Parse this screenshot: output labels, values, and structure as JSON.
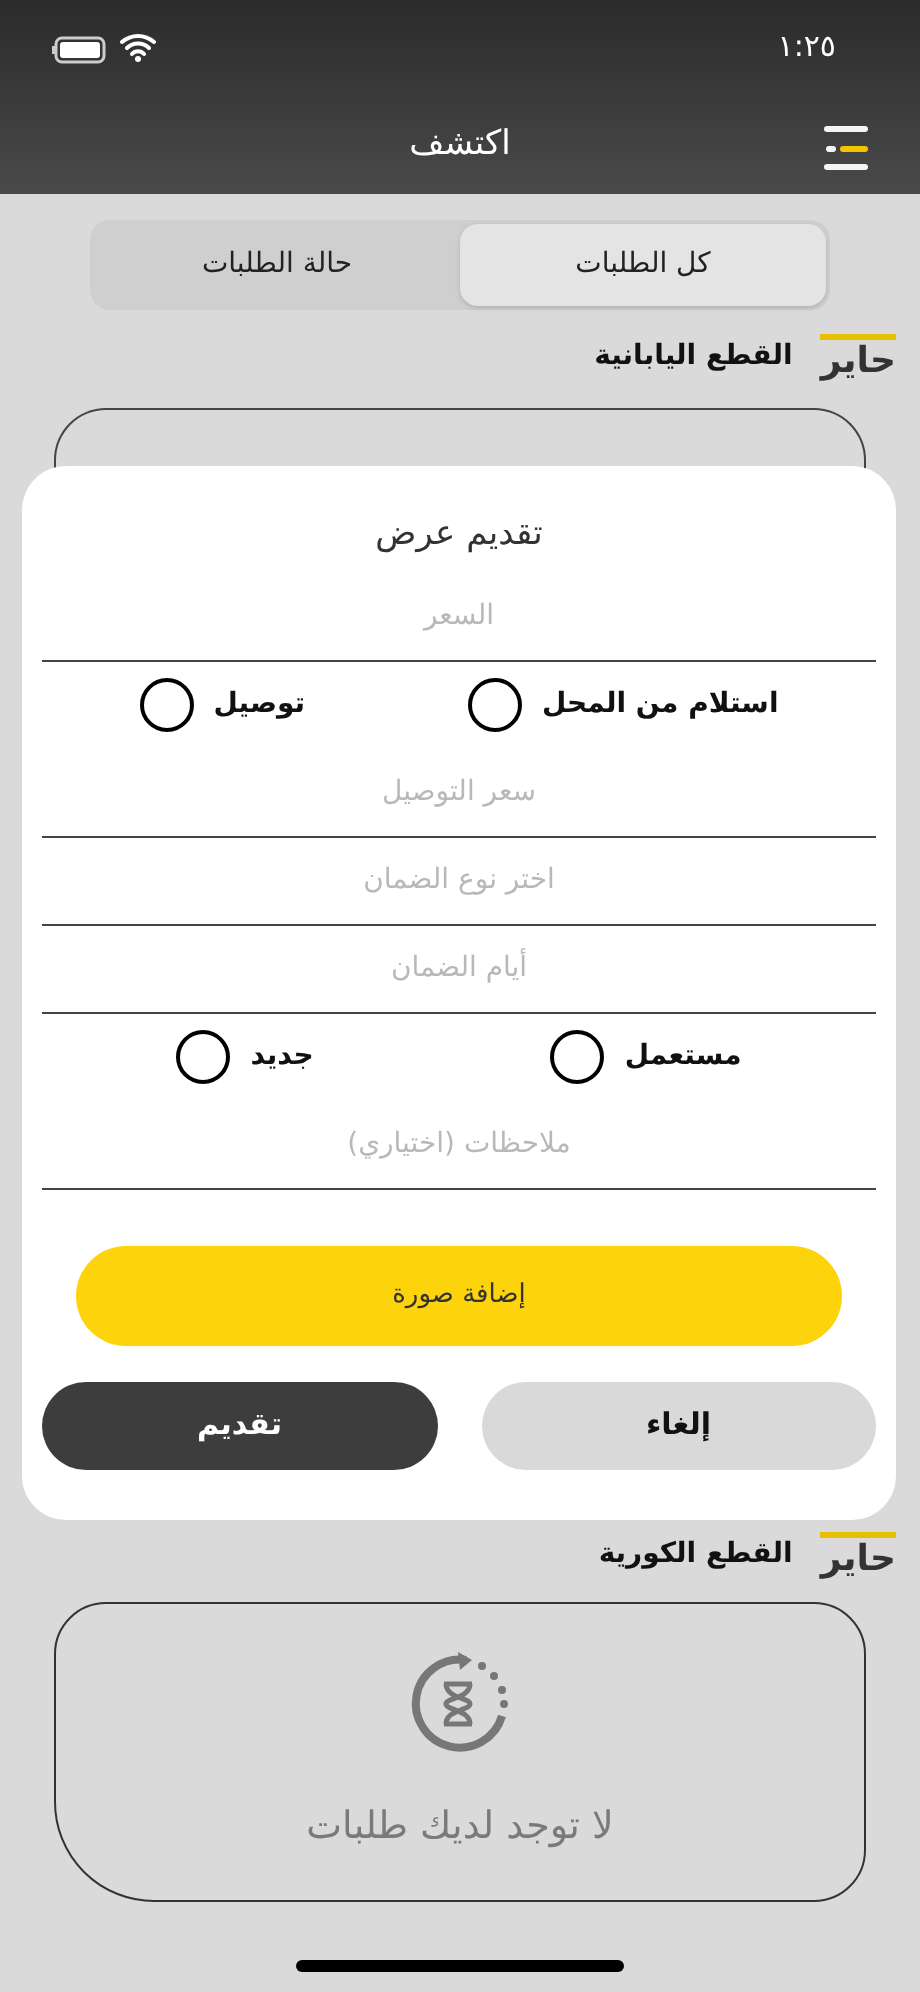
{
  "status_bar": {
    "time": "١:٢٥"
  },
  "header": {
    "title": "اكتشف"
  },
  "tabs": [
    {
      "label": "كل الطلبات",
      "selected": true
    },
    {
      "label": "حالة الطلبات",
      "selected": false
    }
  ],
  "sections": [
    {
      "logo": "حاير",
      "title": "القطع اليابانية"
    },
    {
      "logo": "حاير",
      "title": "القطع الكورية"
    }
  ],
  "empty_state": {
    "message": "لا توجد لديك طلبات"
  },
  "dialog": {
    "title": "تقديم عرض",
    "rows": [
      {
        "kind": "field",
        "placeholder": "السعر"
      },
      {
        "kind": "radios",
        "options": [
          {
            "label": "استلام من المحل",
            "selected": false
          },
          {
            "label": "توصيل",
            "selected": false
          }
        ]
      },
      {
        "kind": "field",
        "placeholder": "سعر التوصيل"
      },
      {
        "kind": "field",
        "placeholder": "اختر نوع الضمان"
      },
      {
        "kind": "field",
        "placeholder": "أيام الضمان"
      },
      {
        "kind": "radios",
        "options": [
          {
            "label": "مستعمل",
            "selected": false
          },
          {
            "label": "جديد",
            "selected": false
          }
        ]
      },
      {
        "kind": "field",
        "placeholder": "ملاحظات (اختياري)"
      }
    ],
    "add_image_button": "إضافة صورة",
    "buttons": [
      {
        "label": "إلغاء",
        "kind": "secondary"
      },
      {
        "label": "تقديم",
        "kind": "primary"
      }
    ]
  }
}
